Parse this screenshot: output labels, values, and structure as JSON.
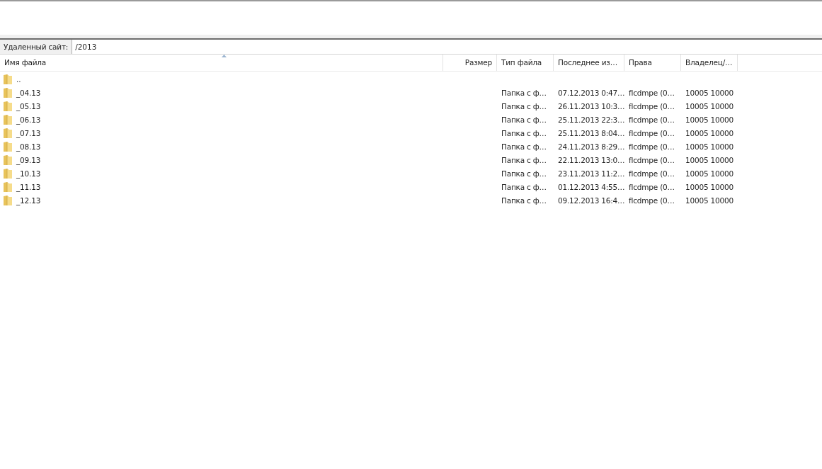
{
  "remote_site": {
    "label": "Удаленный сайт:",
    "path": "/2013"
  },
  "table": {
    "columns": [
      {
        "label": "Имя файла",
        "sorted": true
      },
      {
        "label": "Размер",
        "sorted": false
      },
      {
        "label": "Тип файла",
        "sorted": false
      },
      {
        "label": "Последнее из…",
        "sorted": false
      },
      {
        "label": "Права",
        "sorted": false
      },
      {
        "label": "Владелец/…",
        "sorted": false
      }
    ],
    "rows": [
      {
        "name": "..",
        "type": "",
        "modified": "",
        "permissions": "",
        "owner": ""
      },
      {
        "name": "_04.13",
        "type": "Папка с ф…",
        "modified": "07.12.2013 0:47…",
        "permissions": "flcdmpe (0…",
        "owner": "10005 10000"
      },
      {
        "name": "_05.13",
        "type": "Папка с ф…",
        "modified": "26.11.2013 10:3…",
        "permissions": "flcdmpe (0…",
        "owner": "10005 10000"
      },
      {
        "name": "_06.13",
        "type": "Папка с ф…",
        "modified": "25.11.2013 22:3…",
        "permissions": "flcdmpe (0…",
        "owner": "10005 10000"
      },
      {
        "name": "_07.13",
        "type": "Папка с ф…",
        "modified": "25.11.2013 8:04…",
        "permissions": "flcdmpe (0…",
        "owner": "10005 10000"
      },
      {
        "name": "_08.13",
        "type": "Папка с ф…",
        "modified": "24.11.2013 8:29…",
        "permissions": "flcdmpe (0…",
        "owner": "10005 10000"
      },
      {
        "name": "_09.13",
        "type": "Папка с ф…",
        "modified": "22.11.2013 13:0…",
        "permissions": "flcdmpe (0…",
        "owner": "10005 10000"
      },
      {
        "name": "_10.13",
        "type": "Папка с ф…",
        "modified": "23.11.2013 11:2…",
        "permissions": "flcdmpe (0…",
        "owner": "10005 10000"
      },
      {
        "name": "_11.13",
        "type": "Папка с ф…",
        "modified": "01.12.2013 4:55…",
        "permissions": "flcdmpe (0…",
        "owner": "10005 10000"
      },
      {
        "name": "_12.13",
        "type": "Папка с ф…",
        "modified": "09.12.2013 16:4…",
        "permissions": "flcdmpe (0…",
        "owner": "10005 10000"
      }
    ]
  }
}
